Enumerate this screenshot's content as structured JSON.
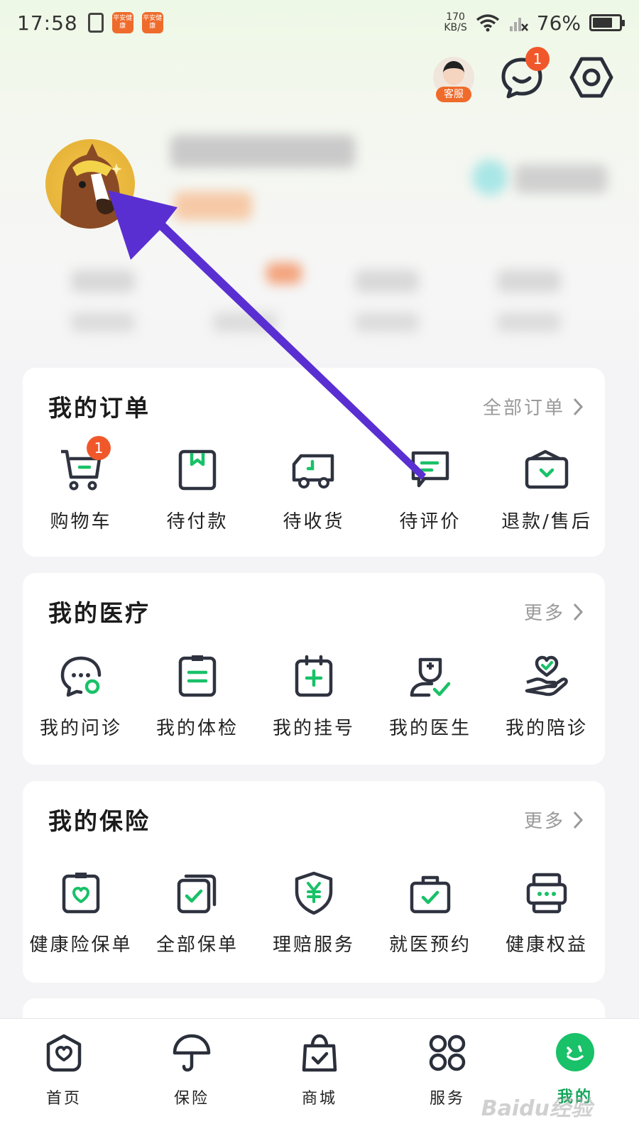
{
  "status_bar": {
    "time": "17:58",
    "app_badge_1": "平安健康",
    "app_badge_2": "平安健康",
    "speed_value": "170",
    "speed_unit": "KB/S",
    "battery": "76%",
    "battery_level": 0.76
  },
  "header": {
    "customer_service_label": "客服",
    "message_badge": "1"
  },
  "orders": {
    "title": "我的订单",
    "more": "全部订单",
    "items": [
      {
        "label": "购物车",
        "icon": "shopping-cart-icon",
        "badge": "1"
      },
      {
        "label": "待付款",
        "icon": "wallet-icon"
      },
      {
        "label": "待收货",
        "icon": "delivery-truck-icon"
      },
      {
        "label": "待评价",
        "icon": "comment-icon"
      },
      {
        "label": "退款/售后",
        "icon": "refund-icon"
      }
    ]
  },
  "medical": {
    "title": "我的医疗",
    "more": "更多",
    "items": [
      {
        "label": "我的问诊",
        "icon": "chat-consult-icon"
      },
      {
        "label": "我的体检",
        "icon": "clipboard-icon"
      },
      {
        "label": "我的挂号",
        "icon": "calendar-plus-icon"
      },
      {
        "label": "我的医生",
        "icon": "doctor-icon"
      },
      {
        "label": "我的陪诊",
        "icon": "hand-heart-icon"
      }
    ]
  },
  "insurance": {
    "title": "我的保险",
    "more": "更多",
    "items": [
      {
        "label": "健康险保单",
        "icon": "policy-heart-icon"
      },
      {
        "label": "全部保单",
        "icon": "policies-icon"
      },
      {
        "label": "理赔服务",
        "icon": "shield-yuan-icon"
      },
      {
        "label": "就医预约",
        "icon": "briefcase-check-icon"
      },
      {
        "label": "健康权益",
        "icon": "gift-card-icon"
      }
    ]
  },
  "tab_bar": {
    "items": [
      {
        "label": "首页",
        "icon": "home-icon"
      },
      {
        "label": "保险",
        "icon": "umbrella-icon"
      },
      {
        "label": "商城",
        "icon": "shopping-bag-icon"
      },
      {
        "label": "服务",
        "icon": "grid-icon"
      },
      {
        "label": "我的",
        "icon": "me-icon",
        "active": true
      }
    ]
  },
  "watermark": "Baidu经验",
  "colors": {
    "accent_green": "#19c168",
    "badge_orange": "#f0582b",
    "arrow_purple": "#5a2fd2"
  }
}
